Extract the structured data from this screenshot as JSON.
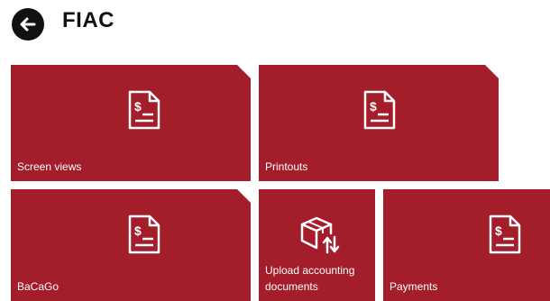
{
  "header": {
    "title": "FIAC",
    "back_icon": "arrow-left-icon"
  },
  "colors": {
    "tile_background": "#a31d2b",
    "tile_text": "#ffffff",
    "header_text": "#111111"
  },
  "tiles": [
    {
      "label": "Screen views",
      "icon": "invoice-dollar-icon"
    },
    {
      "label": "Printouts",
      "icon": "invoice-dollar-icon"
    },
    {
      "label": "BaCaGo",
      "icon": "invoice-dollar-icon"
    },
    {
      "label": "Upload accounting documents",
      "icon": "box-upload-icon"
    },
    {
      "label": "Payments",
      "icon": "invoice-dollar-icon"
    }
  ]
}
